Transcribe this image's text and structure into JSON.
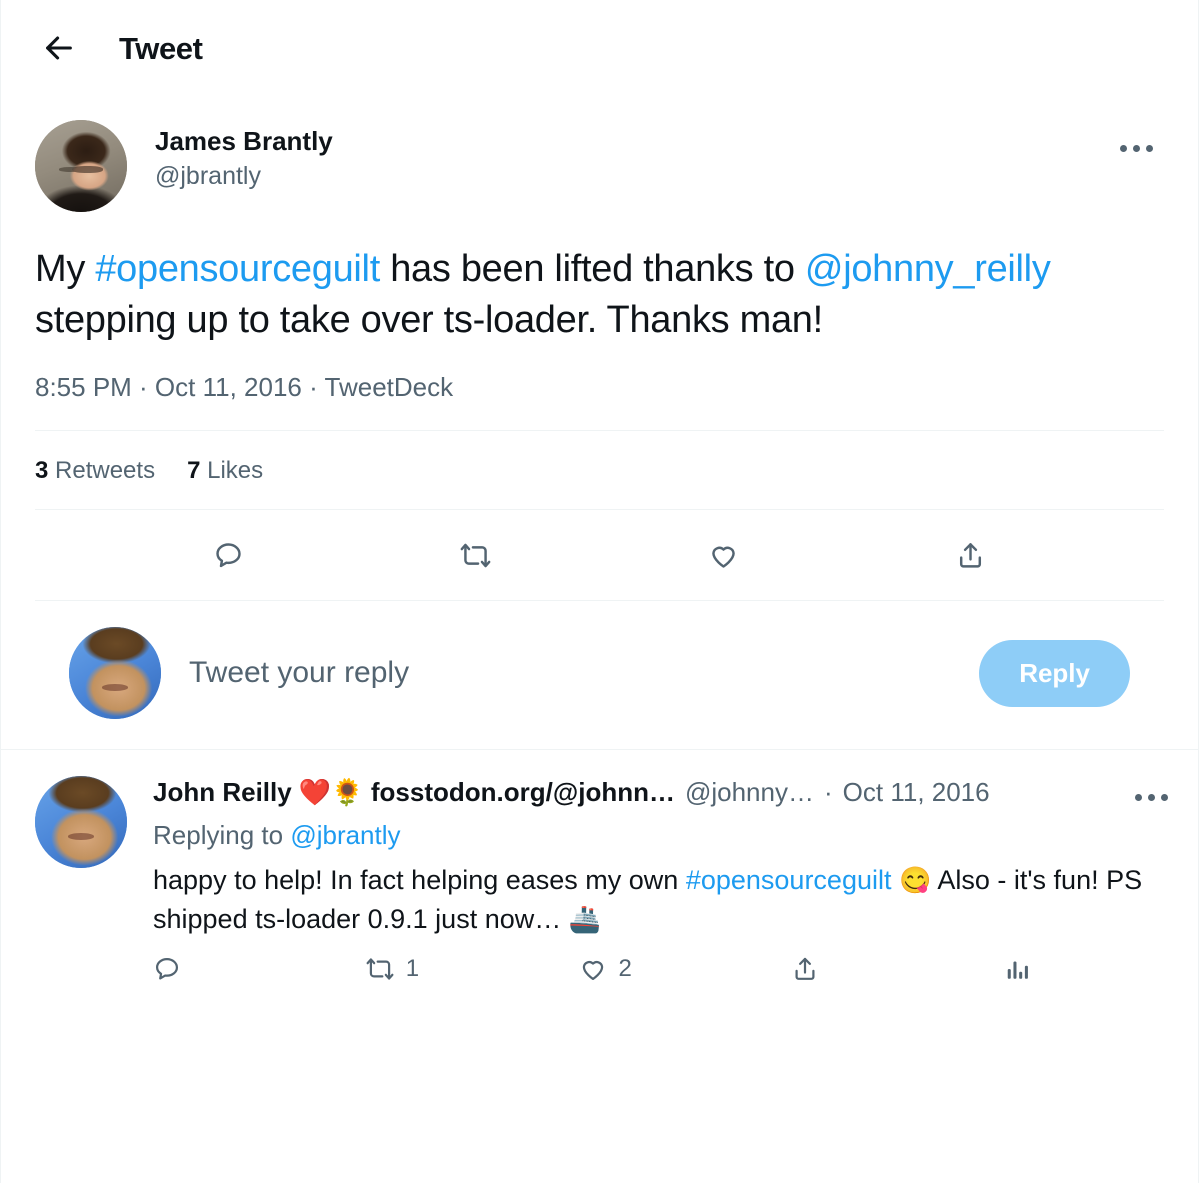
{
  "header": {
    "back_icon": "arrow-left-icon",
    "title": "Tweet"
  },
  "main_tweet": {
    "avatar_name": "james-brantly-avatar",
    "author_name": "James Brantly",
    "author_handle": "@jbrantly",
    "more_icon": "more-options-icon",
    "text_parts": [
      {
        "type": "plain",
        "text": "My "
      },
      {
        "type": "hashtag",
        "text": "#opensourceguilt"
      },
      {
        "type": "plain",
        "text": " has been lifted thanks to "
      },
      {
        "type": "mention",
        "text": "@johnny_reilly"
      },
      {
        "type": "plain",
        "text": " stepping up to take over ts-loader. Thanks man!"
      }
    ],
    "text_plain": "My #opensourceguilt has been lifted thanks to @johnny_reilly stepping up to take over ts-loader. Thanks man!",
    "time": "8:55 PM",
    "date": "Oct 11, 2016",
    "source": "TweetDeck",
    "timestamp_full": "8:55 PM · Oct 11, 2016 · TweetDeck",
    "stats": [
      {
        "count": "3",
        "label": "Retweets"
      },
      {
        "count": "7",
        "label": "Likes"
      }
    ],
    "actions": [
      {
        "name": "reply-action",
        "icon": "reply-icon"
      },
      {
        "name": "retweet-action",
        "icon": "retweet-icon"
      },
      {
        "name": "like-action",
        "icon": "heart-icon"
      },
      {
        "name": "share-action",
        "icon": "share-icon"
      }
    ]
  },
  "composer": {
    "avatar_name": "john-reilly-avatar",
    "placeholder": "Tweet your reply",
    "value": "",
    "reply_button_label": "Reply",
    "reply_button_color": "#8ecdf7"
  },
  "reply": {
    "avatar_name": "john-reilly-avatar",
    "author_name": "John Reilly ❤️🌻 fosstodon.org/@johnn…",
    "author_handle": "@johnny…",
    "separator": "·",
    "date": "Oct 11, 2016",
    "more_icon": "more-options-icon",
    "replying_to_prefix": "Replying to ",
    "replying_to_handle": "@jbrantly",
    "text_parts": [
      {
        "type": "plain",
        "text": "happy to help! In fact helping eases my own "
      },
      {
        "type": "hashtag",
        "text": "#opensourceguilt"
      },
      {
        "type": "emoji",
        "text": "😋"
      },
      {
        "type": "plain",
        "text": " Also - it's fun! PS shipped ts-loader 0.9.1 just now… "
      },
      {
        "type": "emoji",
        "text": "🚢"
      }
    ],
    "text_plain": "happy to help! In fact helping eases my own #opensourceguilt 😋 Also - it's fun! PS shipped ts-loader 0.9.1 just now… 🚢",
    "actions": [
      {
        "name": "reply-action",
        "icon": "reply-icon",
        "count": ""
      },
      {
        "name": "retweet-action",
        "icon": "retweet-icon",
        "count": "1"
      },
      {
        "name": "like-action",
        "icon": "heart-icon",
        "count": "2"
      },
      {
        "name": "share-action",
        "icon": "share-icon",
        "count": ""
      },
      {
        "name": "analytics-action",
        "icon": "bar-chart-icon",
        "count": ""
      }
    ]
  },
  "colors": {
    "link": "#1d9bf0",
    "text": "#0f1419",
    "muted": "#536471",
    "divider": "#eff3f4",
    "background": "#ffffff"
  }
}
